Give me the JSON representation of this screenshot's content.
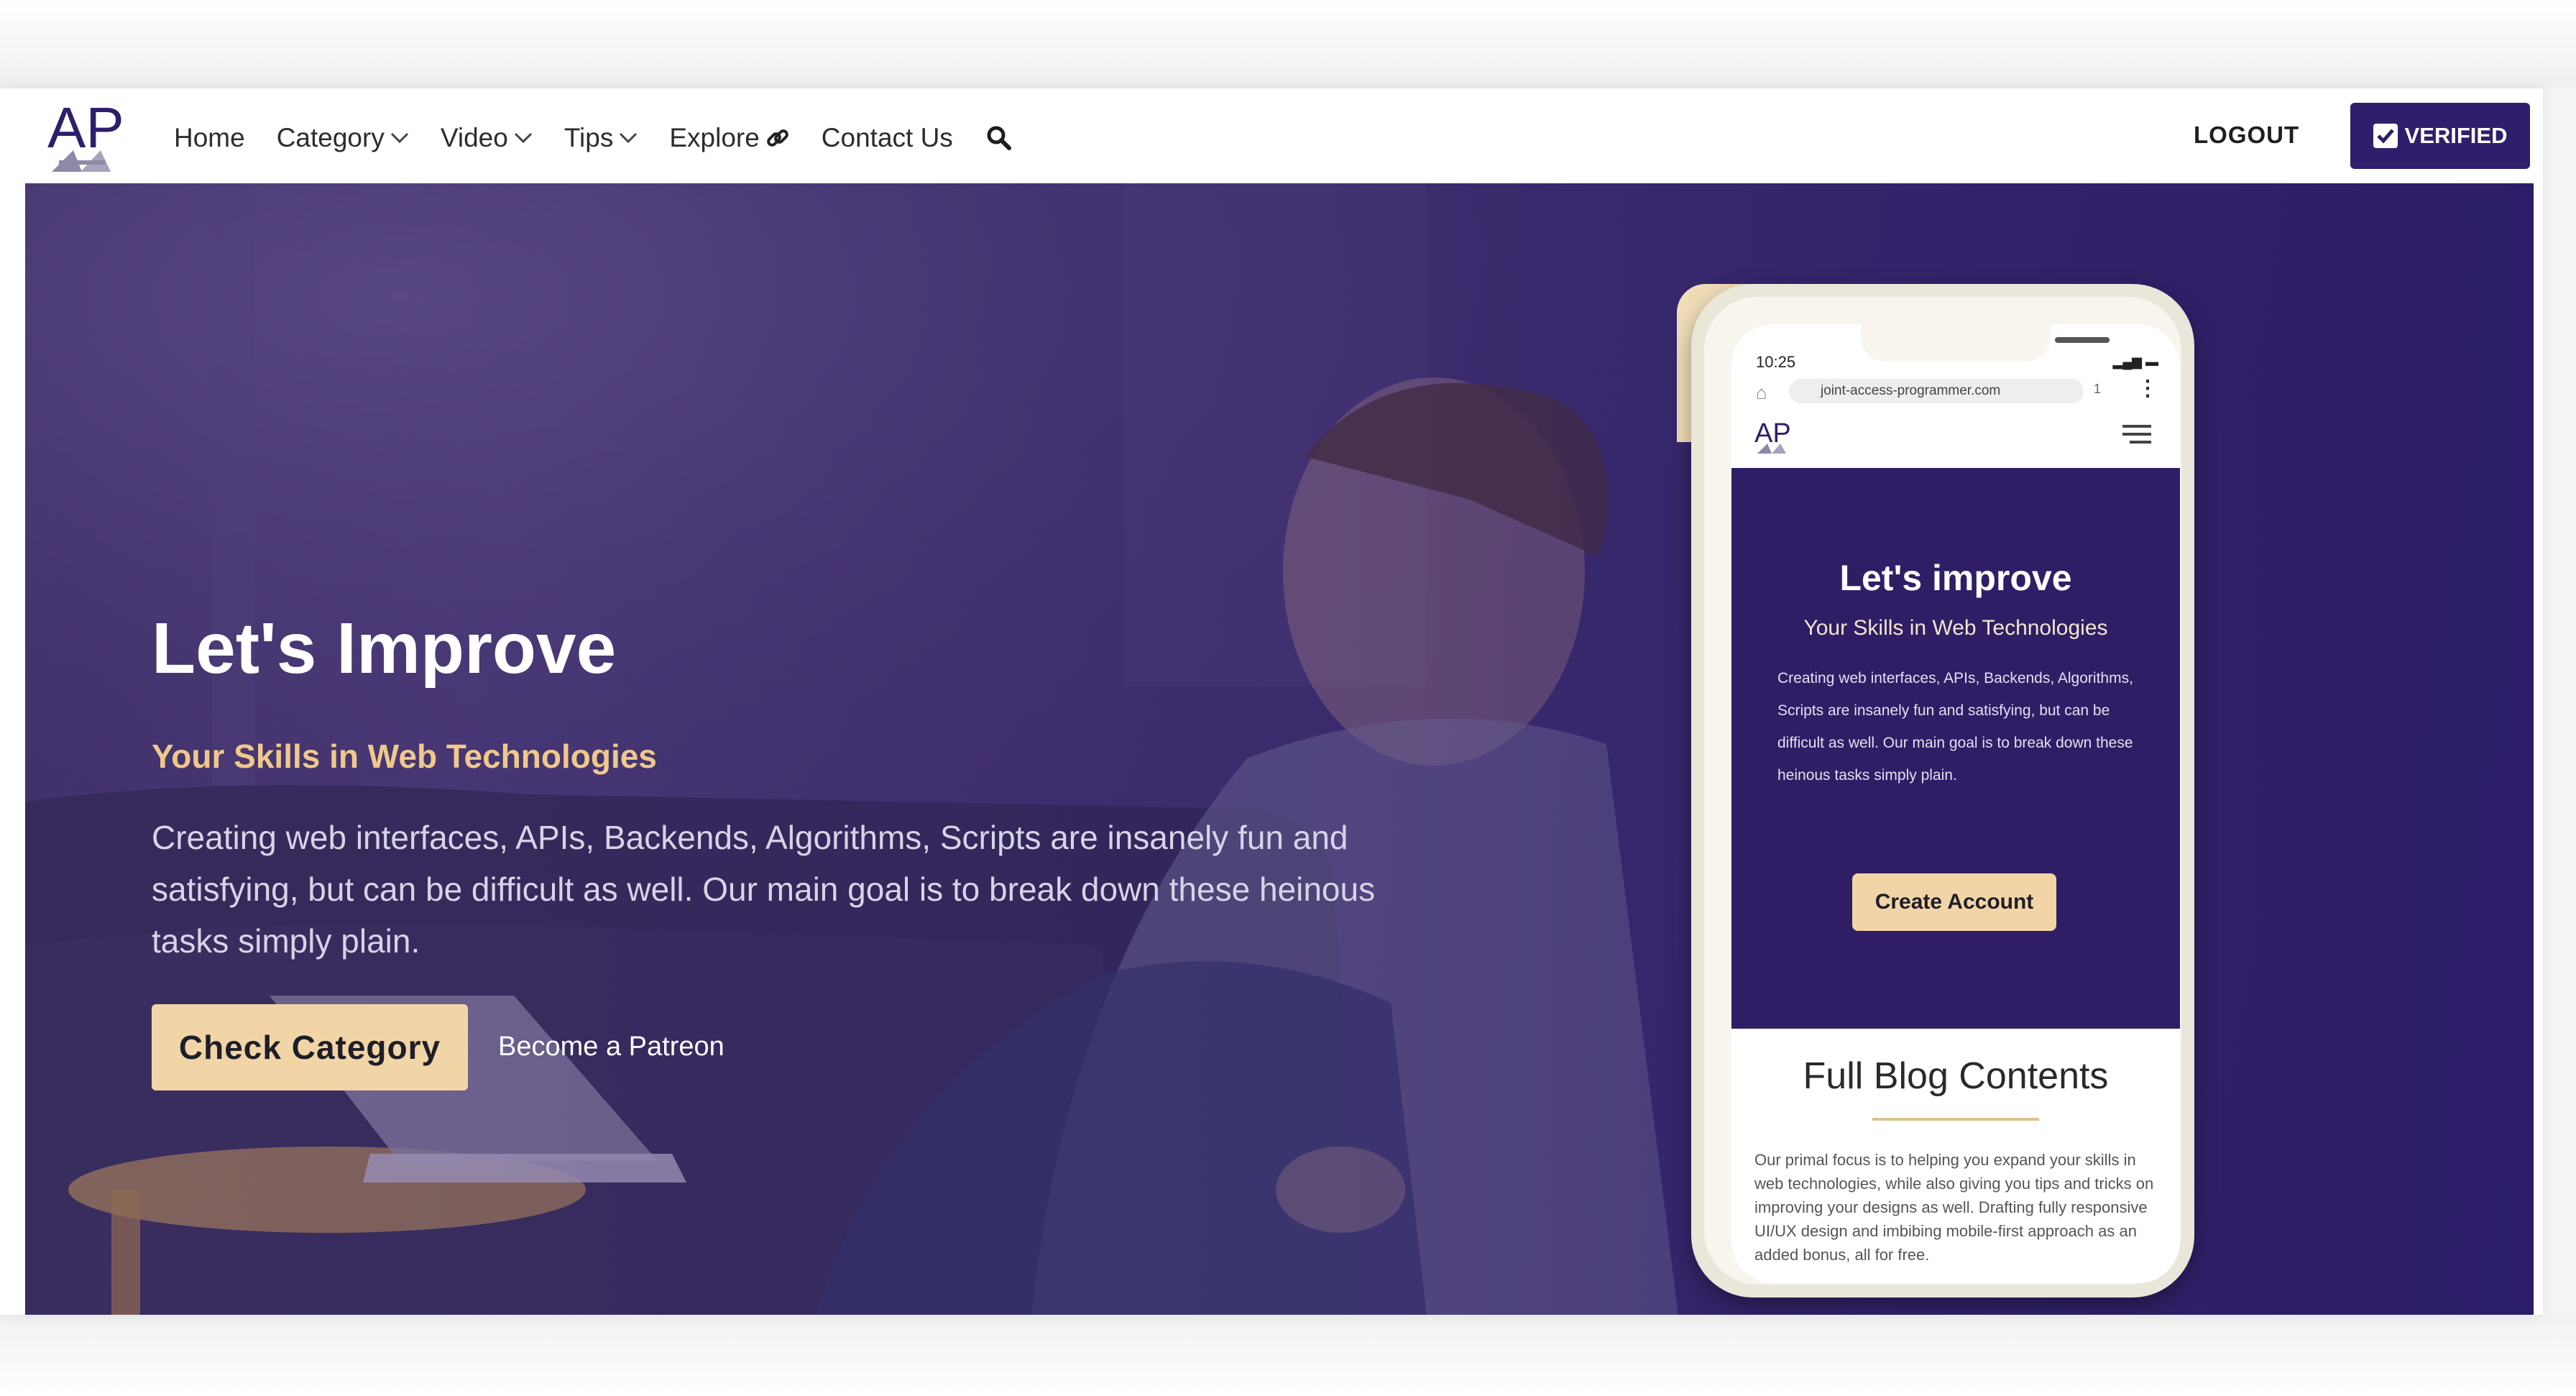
{
  "nav": {
    "logo_text": "AP",
    "items": [
      {
        "label": "Home",
        "dropdown": false
      },
      {
        "label": "Category",
        "dropdown": true
      },
      {
        "label": "Video",
        "dropdown": true
      },
      {
        "label": "Tips",
        "dropdown": true
      },
      {
        "label": "Explore",
        "dropdown": false,
        "icon": "link-icon"
      },
      {
        "label": "Contact Us",
        "dropdown": false
      }
    ],
    "search_icon": "search-icon",
    "logout_label": "LOGOUT",
    "verified_label": "VERIFIED"
  },
  "hero": {
    "title": "Let's Improve",
    "subtitle": "Your Skills in Web Technologies",
    "description": "Creating web interfaces, APIs, Backends, Algorithms, Scripts are insanely fun and satisfying, but can be difficult as well. Our main goal is to break down these heinous tasks simply plain.",
    "primary_button": "Check Category",
    "secondary_link": "Become a Patreon"
  },
  "phone": {
    "status_time": "10:25",
    "url": "joint-access-programmer.com",
    "tab_count": "1",
    "logo_text": "AP",
    "hero_title": "Let's improve",
    "hero_subtitle": "Your Skills in Web Technologies",
    "hero_description": "Creating web interfaces, APIs, Backends, Algorithms, Scripts are insanely fun and satisfying, but can be difficult as well. Our main goal is to break down these heinous tasks simply plain.",
    "hero_button": "Create Account",
    "section_title": "Full Blog Contents",
    "section_description": "Our primal focus is to helping you expand your skills in web technologies, while also giving you tips and tricks on improving your designs as well. Drafting fully responsive UI/UX design and imbibing mobile-first approach as an added bonus, all for free."
  },
  "colors": {
    "brand_purple": "#2f1e6b",
    "accent_gold": "#f2d5a6",
    "subtitle_gold": "#efc98a"
  }
}
